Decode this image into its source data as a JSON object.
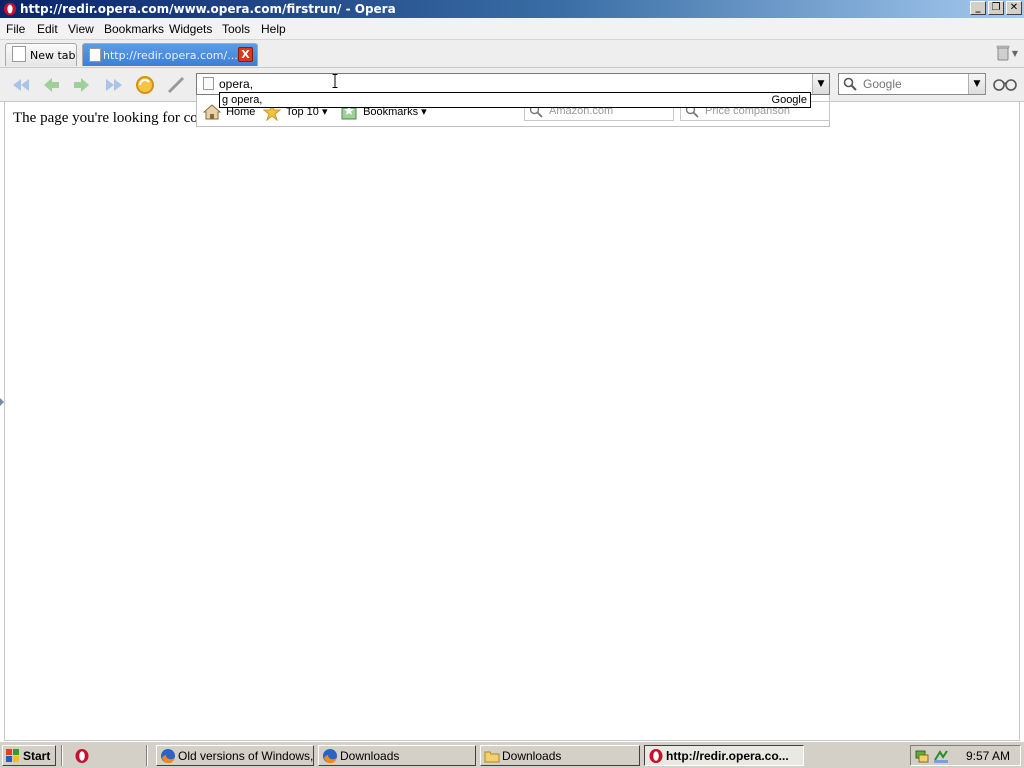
{
  "window": {
    "title": "http://redir.opera.com/www.opera.com/firstrun/ - Opera",
    "controls": {
      "minimize": "_",
      "maximize": "❐",
      "close": "✕"
    }
  },
  "menu": [
    "File",
    "Edit",
    "View",
    "Bookmarks",
    "Widgets",
    "Tools",
    "Help"
  ],
  "tabs": [
    {
      "label": "New tab",
      "icon": "page-icon",
      "active": false
    },
    {
      "label": "http://redir.opera.com/...",
      "icon": "page-icon",
      "active": true,
      "close": "X"
    }
  ],
  "toolbar": {
    "address_value": "opera,",
    "address_dropdown": "▼",
    "search_placeholder": "Google",
    "search_dropdown": "▼"
  },
  "autocomplete": {
    "query": "g opera,",
    "engine": "Google"
  },
  "speed_bar": {
    "home": "Home",
    "top10": "Top 10",
    "bookmarks": "Bookmarks",
    "search1": "Amazon.com",
    "search2": "Price comparison"
  },
  "page": {
    "text": "The page you're looking for co"
  },
  "taskbar": {
    "start": "Start",
    "tasks": [
      {
        "label": "Old versions of Windows,...",
        "icon": "firefox-icon",
        "active": false
      },
      {
        "label": "Downloads",
        "icon": "firefox-icon",
        "active": false
      },
      {
        "label": "Downloads",
        "icon": "folder-icon",
        "active": false
      },
      {
        "label": "http://redir.opera.co...",
        "icon": "opera-icon",
        "active": true
      }
    ],
    "clock": "9:57 AM"
  },
  "colors": {
    "title_gradient_start": "#0a246a",
    "tab_active": "#3b7fd6",
    "close_red": "#d9381e"
  }
}
